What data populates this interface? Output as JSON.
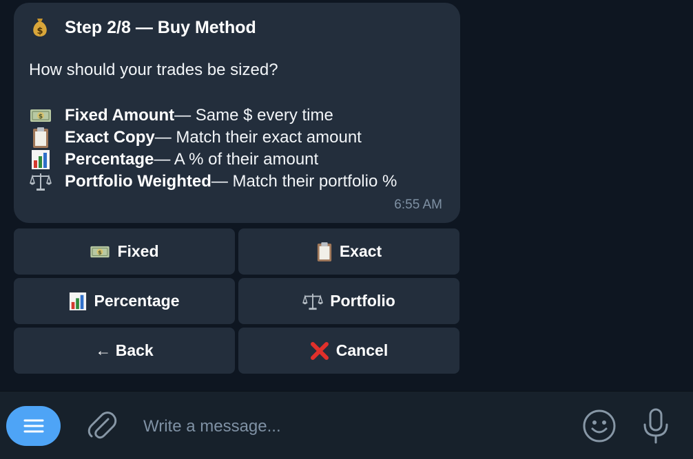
{
  "message": {
    "title_icon": "money-bag-icon",
    "title": "Step 2/8 — Buy Method",
    "question": "How should your trades be sized?",
    "options": [
      {
        "icon": "banknote-icon",
        "name": "Fixed Amount",
        "desc": " — Same $ every time"
      },
      {
        "icon": "clipboard-icon",
        "name": "Exact Copy",
        "desc": " — Match their exact amount"
      },
      {
        "icon": "bar-chart-icon",
        "name": "Percentage",
        "desc": " — A % of their amount"
      },
      {
        "icon": "scales-icon",
        "name": "Portfolio Weighted",
        "desc": " — Match their portfolio %"
      }
    ],
    "time": "6:55 AM"
  },
  "keyboard": {
    "fixed": {
      "label": "Fixed",
      "icon": "banknote-icon"
    },
    "exact": {
      "label": "Exact",
      "icon": "clipboard-icon"
    },
    "percentage": {
      "label": "Percentage",
      "icon": "bar-chart-icon"
    },
    "portfolio": {
      "label": "Portfolio",
      "icon": "scales-icon"
    },
    "back": {
      "label": "← Back"
    },
    "cancel": {
      "label": "Cancel",
      "icon": "cross-mark-icon",
      "color": "#e0302b"
    }
  },
  "composer": {
    "placeholder": "Write a message...",
    "accent": "#4ea4f6"
  }
}
